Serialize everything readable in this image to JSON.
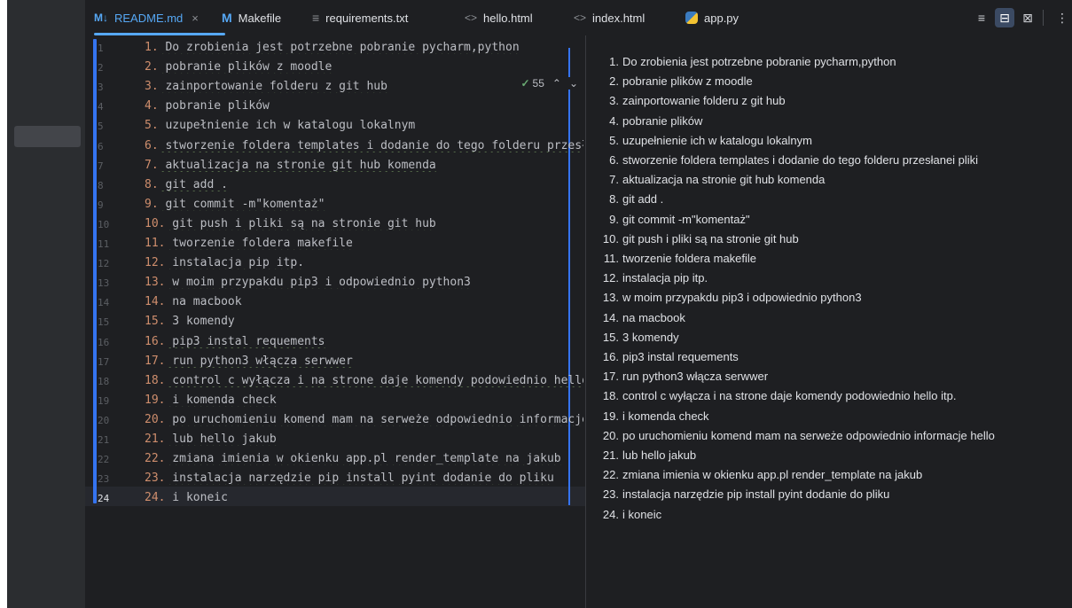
{
  "tabs": [
    {
      "label": "README.md",
      "icon": "M↓",
      "icon_name": "markdown-icon",
      "active": true
    },
    {
      "label": "Makefile",
      "icon": "M",
      "icon_name": "makefile-icon",
      "active": false
    },
    {
      "label": "requirements.txt",
      "icon": "≡",
      "icon_name": "text-file-icon",
      "active": false
    },
    {
      "label": "hello.html",
      "icon": "<>",
      "icon_name": "html-file-icon",
      "active": false
    },
    {
      "label": "index.html",
      "icon": "<>",
      "icon_name": "html-file-icon",
      "active": false
    },
    {
      "label": "app.py",
      "icon": "",
      "icon_name": "python-file-icon",
      "active": false
    }
  ],
  "tab_close_glyph": "×",
  "toolbar": {
    "editor_only_glyph": "≡",
    "split_glyph": "⊟",
    "preview_glyph": "⊠",
    "more_glyph": "⋮"
  },
  "inspection": {
    "check": "✓",
    "count": "55",
    "up": "⌃",
    "down": "⌄"
  },
  "editor": {
    "current_line": 24,
    "lines": [
      {
        "n": "1",
        "num": "1.",
        "text": " Do zrobienia jest potrzebne pobranie pycharm,python"
      },
      {
        "n": "2",
        "num": "2.",
        "text": " pobranie plików z moodle"
      },
      {
        "n": "3",
        "num": "3.",
        "text": " zainportowanie folderu z git hub"
      },
      {
        "n": "4",
        "num": "4.",
        "text": " pobranie plików"
      },
      {
        "n": "5",
        "num": "5.",
        "text": " uzupełnienie ich w katalogu lokalnym"
      },
      {
        "n": "6",
        "num": "6.",
        "text": " stworzenie foldera templates i dodanie do tego folderu przesłanei pliki"
      },
      {
        "n": "7",
        "num": "7.",
        "text": " aktualizacja na stronie git hub komenda"
      },
      {
        "n": "8",
        "num": "8.",
        "text": " git add ."
      },
      {
        "n": "9",
        "num": "9.",
        "text": " git commit -m\"komentaż\""
      },
      {
        "n": "10",
        "num": "10.",
        "text": " git push i pliki są na stronie git hub"
      },
      {
        "n": "11",
        "num": "11.",
        "text": " tworzenie foldera makefile"
      },
      {
        "n": "12",
        "num": "12.",
        "text": " instalacja pip itp."
      },
      {
        "n": "13",
        "num": "13.",
        "text": " w moim przypakdu pip3 i odpowiednio python3"
      },
      {
        "n": "14",
        "num": "14.",
        "text": " na macbook"
      },
      {
        "n": "15",
        "num": "15.",
        "text": " 3 komendy"
      },
      {
        "n": "16",
        "num": "16.",
        "text": " pip3 instal requements"
      },
      {
        "n": "17",
        "num": "17.",
        "text": " run python3 włącza serwwer"
      },
      {
        "n": "18",
        "num": "18.",
        "text": " control c wyłącza i na strone daje komendy podowiednio hello itp."
      },
      {
        "n": "19",
        "num": "19.",
        "text": " i komenda check"
      },
      {
        "n": "20",
        "num": "20.",
        "text": " po uruchomieniu komend mam na serweże odpowiednio informacje hello"
      },
      {
        "n": "21",
        "num": "21.",
        "text": " lub hello jakub"
      },
      {
        "n": "22",
        "num": "22.",
        "text": " zmiana imienia w okienku app.pl render_template na jakub"
      },
      {
        "n": "23",
        "num": "23.",
        "text": " instalacja narzędzie pip install pyint dodanie do pliku"
      },
      {
        "n": "24",
        "num": "24.",
        "text": " i koneic"
      }
    ]
  },
  "preview": {
    "items": [
      {
        "num": "1.",
        "text": "Do zrobienia jest potrzebne pobranie pycharm,python"
      },
      {
        "num": "2.",
        "text": "pobranie plików z moodle"
      },
      {
        "num": "3.",
        "text": "zainportowanie folderu z git hub"
      },
      {
        "num": "4.",
        "text": "pobranie plików"
      },
      {
        "num": "5.",
        "text": "uzupełnienie ich w katalogu lokalnym"
      },
      {
        "num": "6.",
        "text": "stworzenie foldera templates i dodanie do tego folderu przesłanei pliki"
      },
      {
        "num": "7.",
        "text": "aktualizacja na stronie git hub komenda"
      },
      {
        "num": "8.",
        "text": "git add ."
      },
      {
        "num": "9.",
        "text": "git commit -m\"komentaż\""
      },
      {
        "num": "10.",
        "text": "git push i pliki są na stronie git hub"
      },
      {
        "num": "11.",
        "text": "tworzenie foldera makefile"
      },
      {
        "num": "12.",
        "text": "instalacja pip itp."
      },
      {
        "num": "13.",
        "text": "w moim przypakdu pip3 i odpowiednio python3"
      },
      {
        "num": "14.",
        "text": "na macbook"
      },
      {
        "num": "15.",
        "text": "3 komendy"
      },
      {
        "num": "16.",
        "text": "pip3 instal requements"
      },
      {
        "num": "17.",
        "text": "run python3 włącza serwwer"
      },
      {
        "num": "18.",
        "text": "control c wyłącza i na strone daje komendy podowiednio hello itp."
      },
      {
        "num": "19.",
        "text": "i komenda check"
      },
      {
        "num": "20.",
        "text": "po uruchomieniu komend mam na serweże odpowiednio informacje hello"
      },
      {
        "num": "21.",
        "text": "lub hello jakub"
      },
      {
        "num": "22.",
        "text": "zmiana imienia w okienku app.pl render_template na jakub"
      },
      {
        "num": "23.",
        "text": "instalacja narzędzie pip install pyint dodanie do pliku"
      },
      {
        "num": "24.",
        "text": "i koneic"
      }
    ]
  }
}
